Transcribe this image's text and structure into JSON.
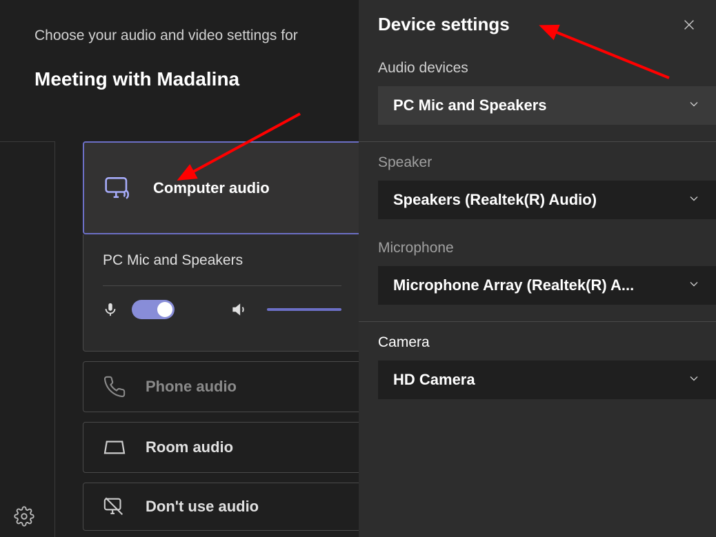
{
  "prejoin": {
    "subtitle": "Choose your audio and video settings for",
    "title": "Meeting with Madalina",
    "option_computer": "Computer audio",
    "device_name": "PC Mic and Speakers",
    "option_phone": "Phone audio",
    "option_room": "Room audio",
    "option_none": "Don't use audio"
  },
  "panel": {
    "title": "Device settings",
    "audio_devices_label": "Audio devices",
    "audio_devices_value": "PC Mic and Speakers",
    "speaker_label": "Speaker",
    "speaker_value": "Speakers (Realtek(R) Audio)",
    "microphone_label": "Microphone",
    "microphone_value": "Microphone Array (Realtek(R) A...",
    "camera_label": "Camera",
    "camera_value": "HD Camera"
  },
  "icons": {
    "monitor": "monitor-speaker-icon",
    "phone": "phone-icon",
    "room": "room-icon",
    "mute": "monitor-off-icon",
    "mic": "microphone-icon",
    "speaker": "speaker-icon",
    "gear": "gear-icon",
    "close": "close-icon",
    "chevron": "chevron-down-icon"
  }
}
